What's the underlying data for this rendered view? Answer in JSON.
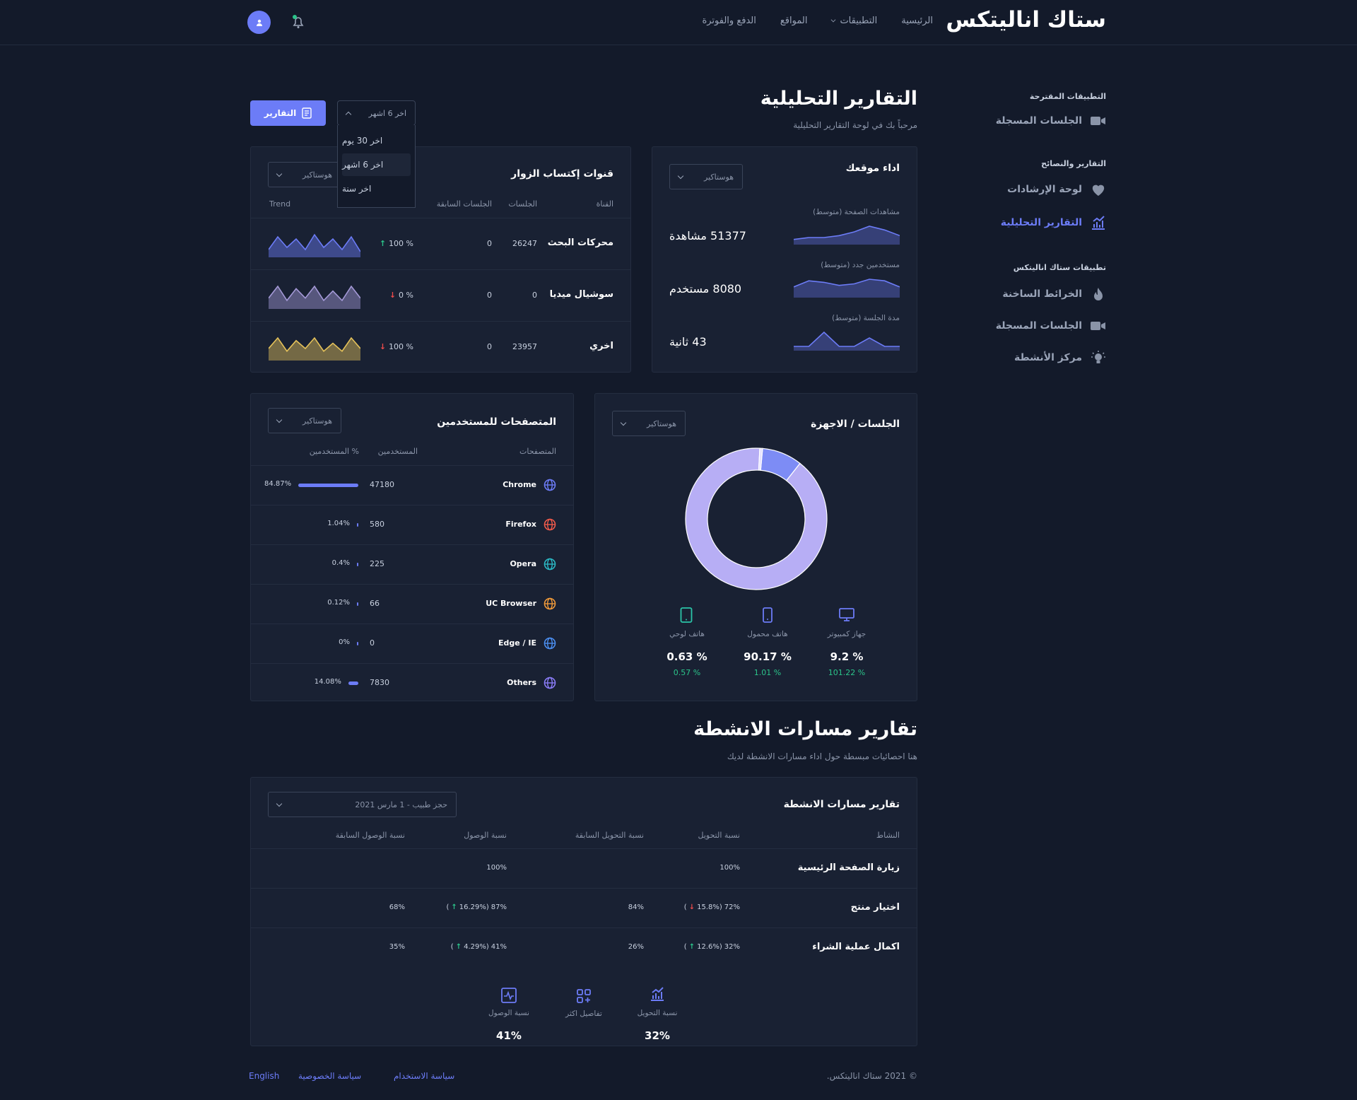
{
  "header": {
    "brand": "ستاك اناليتكس",
    "nav": [
      "الرئيسية",
      "التطبيقات",
      "المواقع",
      "الدفع والفوترة"
    ]
  },
  "sidebar": {
    "sections": [
      {
        "title": "التطبيقات المقترحة",
        "items": [
          {
            "label": "الجلسات المسجلة",
            "icon": "video-icon"
          }
        ]
      },
      {
        "title": "التقارير والنصائح",
        "items": [
          {
            "label": "لوحة الإرشادات",
            "icon": "heart-icon"
          },
          {
            "label": "التقارير التحليلية",
            "icon": "chart-icon",
            "active": true
          }
        ]
      },
      {
        "title": "تطبيقات ستاك اناليتكس",
        "items": [
          {
            "label": "الخرائط الساخنة",
            "icon": "flame-icon"
          },
          {
            "label": "الجلسات المسجلة",
            "icon": "video-icon"
          },
          {
            "label": "مركز الأنشطة",
            "icon": "bulb-icon"
          }
        ]
      }
    ]
  },
  "page": {
    "title": "التقارير التحليلية",
    "subtitle": "مرحباً بك في لوحة التقارير التحليلية",
    "reports_button": "التقارير",
    "range": {
      "selected": "اخر 6 اشهر",
      "options": [
        "اخر 30 يوم",
        "اخر 6 اشهر",
        "اخر سنة"
      ]
    }
  },
  "performance": {
    "title": "اداء موقعك",
    "filter": "هوستاكير",
    "metrics": [
      {
        "label": "مشاهدات الصفحة (متوسط)",
        "value": "51377 مشاهدة",
        "spark": [
          2,
          3,
          3,
          4,
          6,
          9,
          7,
          4
        ]
      },
      {
        "label": "مستخدمين جدد (متوسط)",
        "value": "8080 مستخدم",
        "spark": [
          6,
          10,
          9,
          7,
          8,
          11,
          10,
          6
        ]
      },
      {
        "label": "مدة الجلسة (متوسط)",
        "value": "43 ثانية",
        "spark": [
          1,
          1,
          6,
          1,
          1,
          4,
          1,
          1
        ]
      }
    ]
  },
  "channels": {
    "title": "قنوات إكتساب الزوار",
    "filter": "هوستاكير",
    "columns": [
      "القناة",
      "الجلسات",
      "الجلسات السابقة",
      "",
      "Trend"
    ],
    "rows": [
      {
        "name": "محركات البحث",
        "sessions": "26247",
        "prev": "0",
        "change": "% 100",
        "dir": "up",
        "color": "#6c7cf7",
        "spark": [
          3,
          9,
          4,
          8,
          3,
          10,
          4,
          8,
          3,
          9,
          2
        ]
      },
      {
        "name": "سوشيال ميديا",
        "sessions": "0",
        "prev": "0",
        "change": "% 0",
        "dir": "down",
        "color": "#a59ad8",
        "spark": [
          4,
          9,
          3,
          8,
          4,
          9,
          3,
          7,
          3,
          9,
          4
        ]
      },
      {
        "name": "اخري",
        "sessions": "23957",
        "prev": "0",
        "change": "% 100",
        "dir": "down",
        "color": "#e5c25a",
        "spark": [
          4,
          8,
          3,
          7,
          4,
          8,
          3,
          6,
          3,
          8,
          4
        ]
      }
    ]
  },
  "devices": {
    "title": "الجلسات / الاجهزة",
    "filter": "هوستاكير",
    "items": [
      {
        "label": "جهاز كمبيوتر",
        "pct": "% 9.2",
        "change": "% 101.22",
        "icon": "desktop-icon",
        "share": 9.2
      },
      {
        "label": "هاتف محمول",
        "pct": "% 90.17",
        "change": "% 1.01",
        "icon": "mobile-icon",
        "share": 90.17
      },
      {
        "label": "هاتف لوحي",
        "pct": "% 0.63",
        "change": "% 0.57",
        "icon": "tablet-icon",
        "share": 0.63
      }
    ]
  },
  "browsers": {
    "title": "المتصفحات للمستخدمين",
    "filter": "هوستاكير",
    "columns": [
      "المتصفحات",
      "المستخدمين",
      "% المستخدمين"
    ],
    "rows": [
      {
        "name": "Chrome",
        "users": "47180",
        "pct": "84.87%",
        "share": 84.87,
        "color": "#6c7cf7"
      },
      {
        "name": "Firefox",
        "users": "580",
        "pct": "1.04%",
        "share": 1.04,
        "color": "#ef5a4b"
      },
      {
        "name": "Opera",
        "users": "225",
        "pct": "0.4%",
        "share": 0.4,
        "color": "#2bb8c4"
      },
      {
        "name": "UC Browser",
        "users": "66",
        "pct": "0.12%",
        "share": 0.12,
        "color": "#f09a3a"
      },
      {
        "name": "Edge / IE",
        "users": "0",
        "pct": "0%",
        "share": 0,
        "color": "#4b8ef0"
      },
      {
        "name": "Others",
        "users": "7830",
        "pct": "14.08%",
        "share": 14.08,
        "color": "#8a7cf7"
      }
    ]
  },
  "funnels": {
    "title": "تقارير مسارات الانشطة",
    "subtitle": "هنا احصائيات مبسطة حول اداء مسارات الانشطة لديك",
    "card_title": "تقارير مسارات الانشطة",
    "filter": "حجز طبيب - 1 مارس 2021",
    "columns": [
      "النشاط",
      "نسبة التحويل",
      "نسبة التحويل السابقة",
      "نسبة الوصول",
      "نسبة الوصول السابقة"
    ],
    "rows": [
      {
        "name": "زيارة الصفحة الرئيسية",
        "conv": "100%",
        "conv_prev": "",
        "reach": "100%",
        "reach_prev": ""
      },
      {
        "name": "اختيار منتج",
        "conv": "72% (15.8%",
        "conv_dir": "down",
        "conv_prev": "84%",
        "reach": "87% (16.29%",
        "reach_dir": "up",
        "reach_prev": "68%"
      },
      {
        "name": "اكمال عملية الشراء",
        "conv": "32% (12.6%",
        "conv_dir": "up",
        "conv_prev": "26%",
        "reach": "41% (4.29%",
        "reach_dir": "up",
        "reach_prev": "35%"
      }
    ],
    "summary": [
      {
        "label": "نسبة التحويل",
        "value": "32%",
        "icon": "chart-icon"
      },
      {
        "label": "تفاصيل اكثر",
        "value": "",
        "icon": "apps-icon"
      },
      {
        "label": "نسبة الوصول",
        "value": "41%",
        "icon": "pulse-icon"
      }
    ]
  },
  "footer": {
    "copyright": "© 2021 ستاك اناليتكس.",
    "links": [
      "سياسة الاستخدام",
      "سياسة الخصوصية",
      "English"
    ]
  }
}
